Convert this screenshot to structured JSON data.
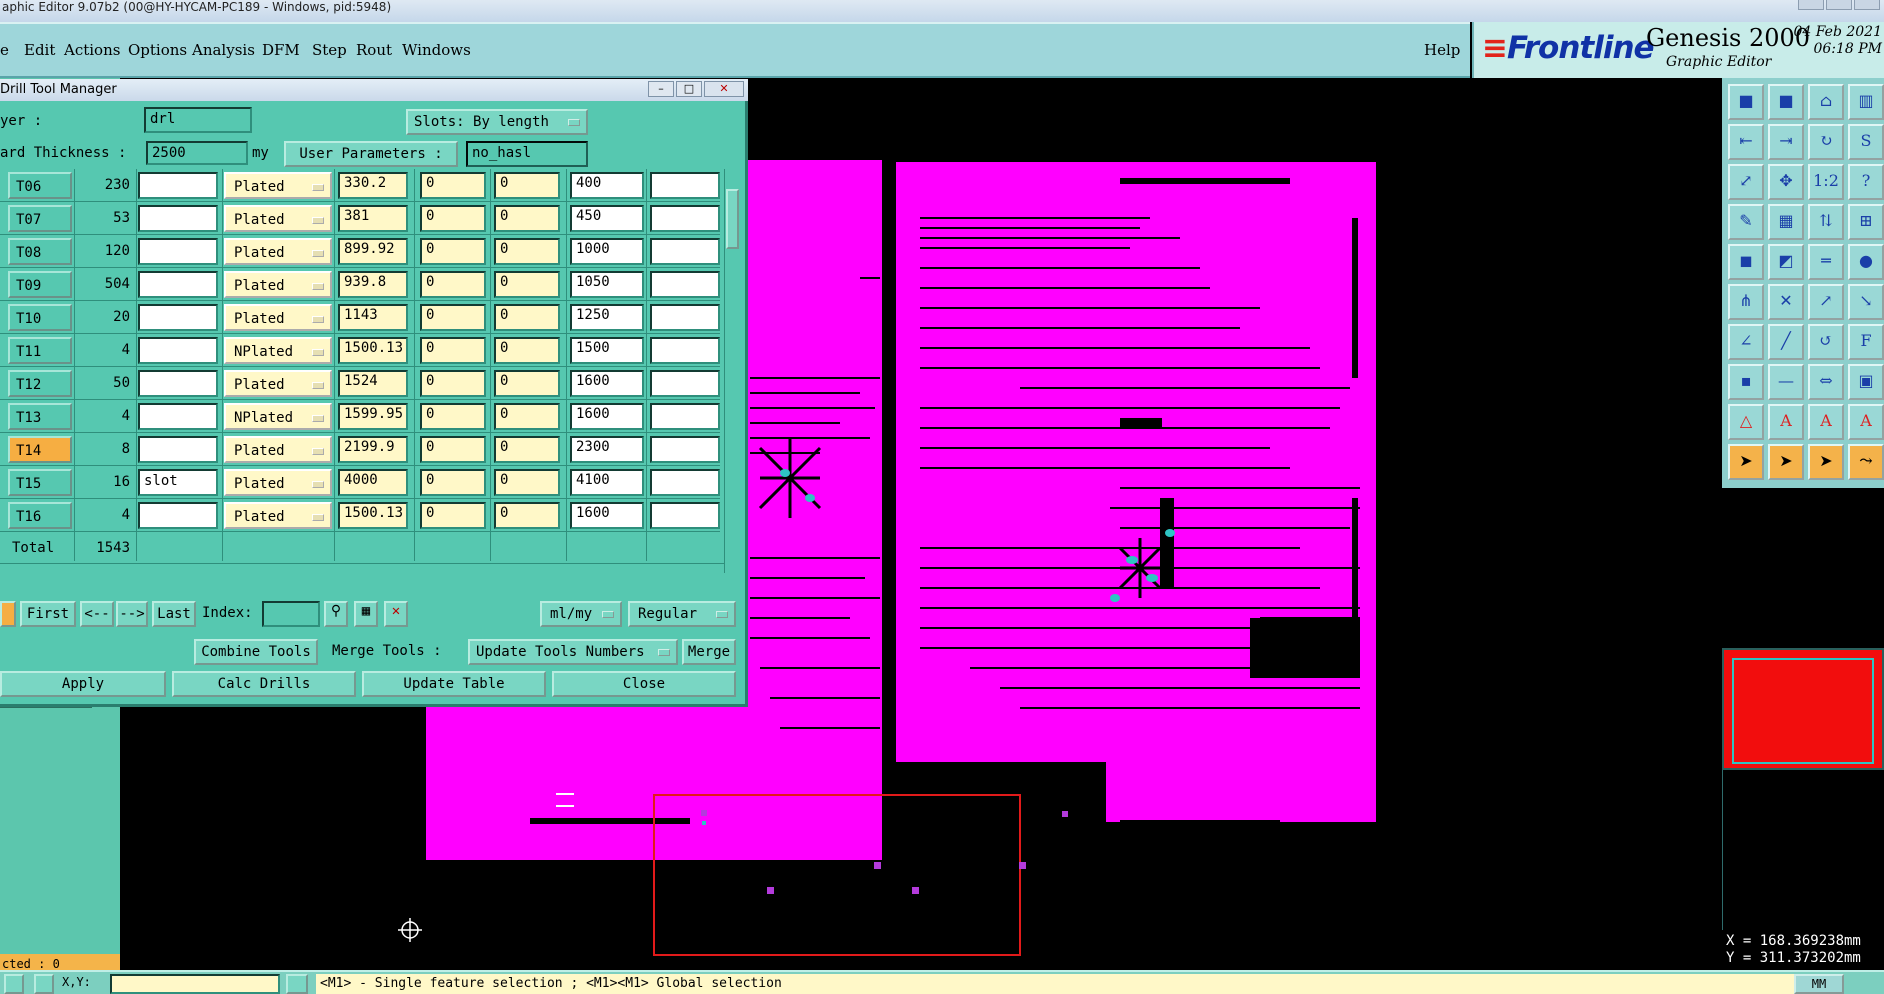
{
  "window": {
    "title": "aphic Editor 9.07b2 (00@HY-HYCAM-PC189 - Windows, pid:5948)"
  },
  "menu": {
    "items": [
      "e",
      "Edit",
      "Actions",
      "Options",
      "Analysis",
      "DFM",
      "Step",
      "Rout",
      "Windows"
    ],
    "help": "Help"
  },
  "brand": {
    "logo": "Frontline",
    "product": "Genesis 2000",
    "subtitle": "Graphic Editor",
    "date": "04 Feb 2021",
    "time": "06:18 PM"
  },
  "dialog": {
    "title": "Drill Tool Manager",
    "layer_label": "yer          :",
    "layer_value": "drl",
    "slots_label": "Slots:",
    "slots_value": "By length",
    "board_thickness_label": "ard Thickness :",
    "board_thickness_value": "2500",
    "units": "my",
    "user_params_label": "User Parameters :",
    "user_params_value": "no_hasl",
    "rows": [
      {
        "tool": "T06",
        "count": "230",
        "note": "",
        "type": "Plated",
        "size": "330.2",
        "p1": "0",
        "p2": "0",
        "fin": "400",
        "extra": ""
      },
      {
        "tool": "T07",
        "count": "53",
        "note": "",
        "type": "Plated",
        "size": "381",
        "p1": "0",
        "p2": "0",
        "fin": "450",
        "extra": ""
      },
      {
        "tool": "T08",
        "count": "120",
        "note": "",
        "type": "Plated",
        "size": "899.92",
        "p1": "0",
        "p2": "0",
        "fin": "1000",
        "extra": ""
      },
      {
        "tool": "T09",
        "count": "504",
        "note": "",
        "type": "Plated",
        "size": "939.8",
        "p1": "0",
        "p2": "0",
        "fin": "1050",
        "extra": ""
      },
      {
        "tool": "T10",
        "count": "20",
        "note": "",
        "type": "Plated",
        "size": "1143",
        "p1": "0",
        "p2": "0",
        "fin": "1250",
        "extra": ""
      },
      {
        "tool": "T11",
        "count": "4",
        "note": "",
        "type": "NPlated",
        "size": "1500.13",
        "p1": "0",
        "p2": "0",
        "fin": "1500",
        "extra": ""
      },
      {
        "tool": "T12",
        "count": "50",
        "note": "",
        "type": "Plated",
        "size": "1524",
        "p1": "0",
        "p2": "0",
        "fin": "1600",
        "extra": ""
      },
      {
        "tool": "T13",
        "count": "4",
        "note": "",
        "type": "NPlated",
        "size": "1599.95",
        "p1": "0",
        "p2": "0",
        "fin": "1600",
        "extra": ""
      },
      {
        "tool": "T14",
        "count": "8",
        "note": "",
        "type": "Plated",
        "size": "2199.9",
        "p1": "0",
        "p2": "0",
        "fin": "2300",
        "extra": ""
      },
      {
        "tool": "T15",
        "count": "16",
        "note": "slot",
        "type": "Plated",
        "size": "4000",
        "p1": "0",
        "p2": "0",
        "fin": "4100",
        "extra": ""
      },
      {
        "tool": "T16",
        "count": "4",
        "note": "",
        "type": "Plated",
        "size": "1500.13",
        "p1": "0",
        "p2": "0",
        "fin": "1600",
        "extra": ""
      }
    ],
    "total_label": "Total",
    "total_value": "1543",
    "nav": {
      "first": "First",
      "prev": "<--",
      "next": "-->",
      "last": "Last",
      "index_label": "Index:",
      "units_combo": "ml/my",
      "mode_combo": "Regular"
    },
    "combine_tools": "Combine Tools",
    "merge_tools_label": "Merge Tools :",
    "update_numbers_combo": "Update Tools Numbers",
    "merge": "Merge",
    "apply": "Apply",
    "calc_drills": "Calc Drills",
    "update_table": "Update Table",
    "close": "Close"
  },
  "selected_text": "cted : 0",
  "coords": {
    "x": "X = 168.369238mm",
    "y": "Y = 311.373202mm"
  },
  "status": {
    "message": "<M1> - Single feature selection ; <M1><M1> Global selection",
    "xy_label": "X,Y:",
    "unit": "MM"
  },
  "colors": {
    "board": "#ff00ff",
    "dialog_bg": "#56c8b0",
    "highlight": "#f6ae42",
    "overview": "#f20d0d"
  }
}
